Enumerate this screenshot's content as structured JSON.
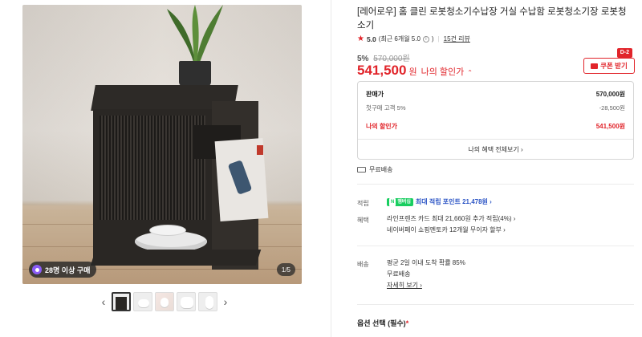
{
  "gallery": {
    "badge_text": "28명 이상 구매",
    "pager_text": "1/5",
    "prev_arrow": "‹",
    "next_arrow": "›",
    "thumbnail_count": 5
  },
  "product": {
    "title": "[레어로우] 홈 클린 로봇청소기수납장 거실 수납함 로봇청소기장 로봇청소기",
    "rating": {
      "star": "★",
      "score": "5.0",
      "recent": "(최근 6개월 5.0",
      "recent_close": ")",
      "info_icon": "i",
      "separator": "|",
      "reviews": "15건 리뷰"
    },
    "discount_percent": "5%",
    "original_price": "570,000원",
    "sale_price": "541,500",
    "sale_unit": "원",
    "sale_label": "나의 할인가",
    "sale_chevron": "⌃"
  },
  "coupon": {
    "d_day": "D-2",
    "label": "쿠폰 받기"
  },
  "price_breakdown": {
    "rows": [
      {
        "label": "판매가",
        "value": "570,000원"
      },
      {
        "label": "첫구매 고객 5%",
        "value": "-28,500원"
      },
      {
        "label": "나의 할인가",
        "value": "541,500원"
      }
    ],
    "more_link": "나의 혜택 전체보기 ›"
  },
  "shipping_badge": "무료배송",
  "points": {
    "label": "적립",
    "npay_n": "N",
    "npay_text": "멤버십",
    "text": "최대 적립 포인트 21,478원 ›"
  },
  "benefits": {
    "label": "혜택",
    "line1": "라인프렌즈 카드 최대 21,660원 추가 적립(4%) ›",
    "line2": "네이버페이 쇼핑멘토카 12개월 무이자 할부 ›"
  },
  "delivery": {
    "label": "배송",
    "line1": "평균 2일 이내 도착 확률 85%",
    "line2": "무료배송",
    "detail_link": "자세히 보기 ›"
  },
  "options": {
    "label": "옵션 선택 (필수)",
    "required_mark": "*"
  },
  "colors": {
    "accent": "#e1242a",
    "point_blue": "#2c55c5",
    "npay_green": "#19ce60"
  }
}
